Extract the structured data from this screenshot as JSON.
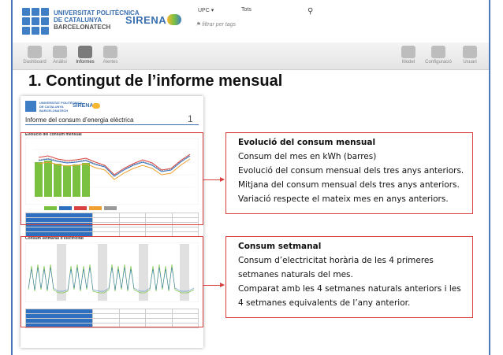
{
  "app": {
    "brand_line1": "UNIVERSITAT POLITÈCNICA",
    "brand_line2": "DE CATALUNYA",
    "brand_line3": "BARCELONATECH",
    "product": "SIRENA",
    "brand_colors": {
      "blue": "#3a6fb0",
      "accent_red": "#d94040"
    }
  },
  "toolbar": {
    "scope_select": "UPC",
    "filter_select": "Tots",
    "search_icon": "search-icon",
    "filter_placeholder": "filtrar per tags"
  },
  "nav": {
    "items": [
      {
        "label": "Dashboard",
        "icon": "gauge-icon",
        "active": false
      },
      {
        "label": "Anàlisi",
        "icon": "chart-icon",
        "active": false
      },
      {
        "label": "Informes",
        "icon": "report-icon",
        "active": true
      },
      {
        "label": "Alertes",
        "icon": "alert-icon",
        "active": false
      }
    ],
    "right_items": [
      {
        "label": "Model",
        "icon": "grid-icon"
      },
      {
        "label": "Configuració",
        "icon": "settings-icon"
      },
      {
        "label": "Usuari",
        "icon": "user-icon"
      }
    ]
  },
  "slide": {
    "title": "1. Contingut de l’informe mensual"
  },
  "report_preview": {
    "title": "Informe del consum d’energia elèctrica",
    "page_number": "1",
    "section1": "Evolució del consum mensual",
    "section2": "Consum setmanal d’electricitat",
    "legend_years": [
      "2014",
      "2013",
      "2012",
      "2011",
      "Mitjana"
    ],
    "legend_colors": [
      "#7ac142",
      "#2f6fbf",
      "#d94040",
      "#f0a030",
      "#999999"
    ]
  },
  "annotations": [
    {
      "heading": "Evolució del consum mensual",
      "lines": [
        "Consum del mes en kWh (barres)",
        "Evolució del consum mensual dels tres anys anteriors.",
        "Mitjana del consum mensual dels tres anys anteriors.",
        "Variació respecte el mateix mes en anys anteriors."
      ]
    },
    {
      "heading": "Consum setmanal",
      "lines": [
        "Consum d’electricitat horària de les 4 primeres",
        "setmanes naturals del mes.",
        "Comparat amb les 4 setmanes naturals anteriors i les",
        "4 setmanes equivalents de l’any anterior."
      ]
    }
  ]
}
